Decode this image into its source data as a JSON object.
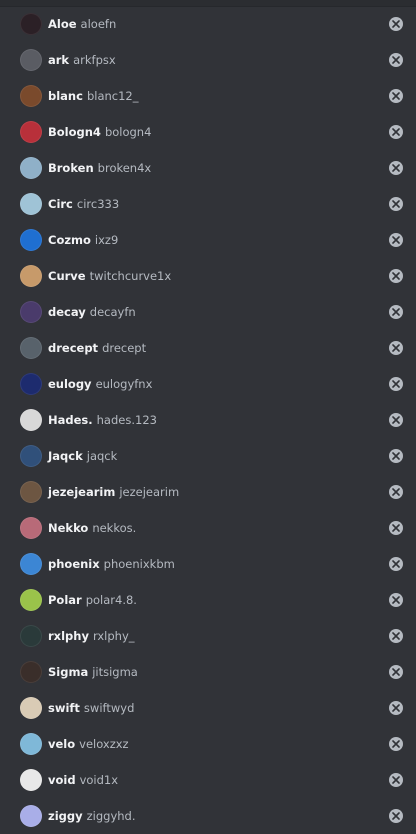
{
  "members": [
    {
      "display": "Aloe",
      "username": "aloefn",
      "avatar_color": "#2b2026",
      "avatar_icon": "user-avatar"
    },
    {
      "display": "ark",
      "username": "arkfpsx",
      "avatar_color": "#5a5c63",
      "avatar_icon": "user-avatar"
    },
    {
      "display": "blanc",
      "username": "blanc12_",
      "avatar_color": "#7a4a2c",
      "avatar_icon": "user-avatar"
    },
    {
      "display": "Bologn4",
      "username": "bologn4",
      "avatar_color": "#b8303a",
      "avatar_icon": "user-avatar"
    },
    {
      "display": "Broken",
      "username": "broken4x",
      "avatar_color": "#8fb0c8",
      "avatar_icon": "user-avatar"
    },
    {
      "display": "Circ",
      "username": "circ333",
      "avatar_color": "#9fc3d6",
      "avatar_icon": "user-avatar"
    },
    {
      "display": "Cozmo",
      "username": "ixz9",
      "avatar_color": "#1f6fd1",
      "avatar_icon": "user-avatar"
    },
    {
      "display": "Curve",
      "username": "twitchcurve1x",
      "avatar_color": "#c79a6a",
      "avatar_icon": "user-avatar"
    },
    {
      "display": "decay",
      "username": "decayfn",
      "avatar_color": "#4a3b6b",
      "avatar_icon": "user-avatar"
    },
    {
      "display": "drecept",
      "username": "drecept",
      "avatar_color": "#58626b",
      "avatar_icon": "user-avatar"
    },
    {
      "display": "eulogy",
      "username": "eulogyfnx",
      "avatar_color": "#1d2b6e",
      "avatar_icon": "user-avatar"
    },
    {
      "display": "Hades.",
      "username": "hades.123",
      "avatar_color": "#d8d8d8",
      "avatar_icon": "user-avatar"
    },
    {
      "display": "Jaqck",
      "username": "jaqck",
      "avatar_color": "#30507a",
      "avatar_icon": "user-avatar"
    },
    {
      "display": "jezejearim",
      "username": "jezejearim",
      "avatar_color": "#6d5642",
      "avatar_icon": "user-avatar"
    },
    {
      "display": "Nekko",
      "username": "nekkos.",
      "avatar_color": "#b86a78",
      "avatar_icon": "user-avatar"
    },
    {
      "display": "phoenix",
      "username": "phoenixkbm",
      "avatar_color": "#3c86d4",
      "avatar_icon": "user-avatar"
    },
    {
      "display": "Polar",
      "username": "polar4.8.",
      "avatar_color": "#9ac34a",
      "avatar_icon": "user-avatar"
    },
    {
      "display": "rxlphy",
      "username": "rxlphy_",
      "avatar_color": "#2a3a3a",
      "avatar_icon": "user-avatar"
    },
    {
      "display": "Sigma",
      "username": "jitsigma",
      "avatar_color": "#3a2e2a",
      "avatar_icon": "user-avatar"
    },
    {
      "display": "swift",
      "username": "swiftwyd",
      "avatar_color": "#d9cbb5",
      "avatar_icon": "user-avatar"
    },
    {
      "display": "velo",
      "username": "veloxzxz",
      "avatar_color": "#7fb8d8",
      "avatar_icon": "user-avatar"
    },
    {
      "display": "void",
      "username": "void1x",
      "avatar_color": "#e8e8e8",
      "avatar_icon": "user-avatar"
    },
    {
      "display": "ziggy",
      "username": "ziggyhd.",
      "avatar_color": "#a9aee8",
      "avatar_icon": "user-avatar"
    }
  ],
  "remove_icon": "close-circle-icon",
  "colors": {
    "background": "#313338",
    "display_name": "#f2f3f5",
    "username": "#b5bac1",
    "remove_button": "#b5bac1"
  }
}
